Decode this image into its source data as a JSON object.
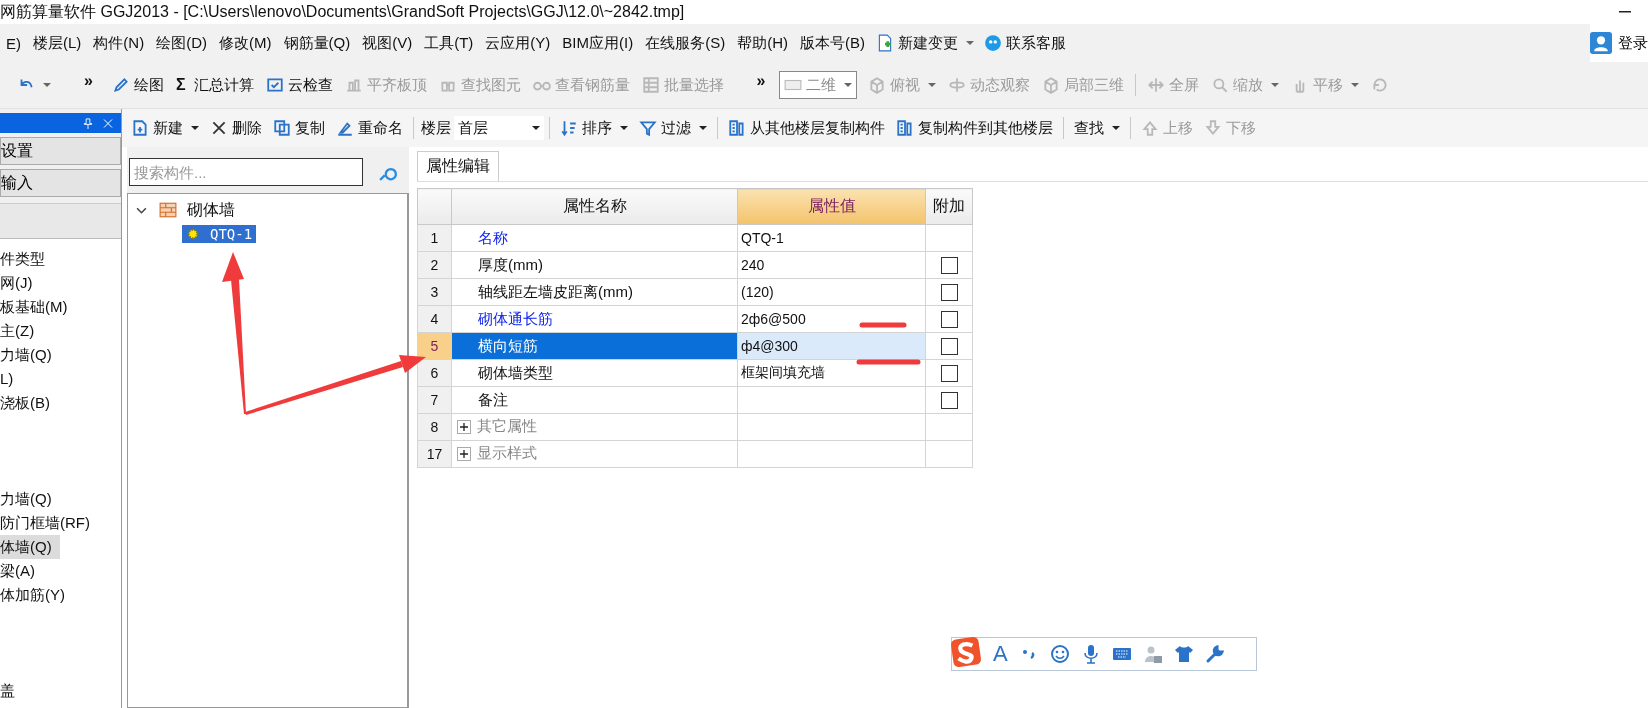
{
  "window": {
    "title": "网筋算量软件 GGJ2013 - [C:\\Users\\lenovo\\Documents\\GrandSoft Projects\\GGJ\\12.0\\~2842.tmp]"
  },
  "menu": {
    "items": [
      "E)",
      "楼层(L)",
      "构件(N)",
      "绘图(D)",
      "修改(M)",
      "钢筋量(Q)",
      "视图(V)",
      "工具(T)",
      "云应用(Y)",
      "BIM应用(I)",
      "在线服务(S)",
      "帮助(H)",
      "版本号(B)"
    ],
    "extras": [
      {
        "label": "新建变更",
        "dropdown": true
      },
      {
        "label": "联系客服",
        "dropdown": false
      }
    ],
    "login": "登录"
  },
  "toolbar": [
    {
      "kind": "icon",
      "disabled": false,
      "dropdown": true
    },
    {
      "kind": "overflow",
      "label": "»"
    },
    {
      "kind": "button",
      "label": "绘图",
      "disabled": false,
      "dropdown": false
    },
    {
      "kind": "button",
      "symbol": "Σ",
      "label": "汇总计算",
      "disabled": false,
      "dropdown": false
    },
    {
      "kind": "button",
      "label": "云检查",
      "disabled": false,
      "dropdown": false
    },
    {
      "kind": "button",
      "label": "平齐板顶",
      "disabled": true,
      "dropdown": false
    },
    {
      "kind": "button",
      "label": "查找图元",
      "disabled": true,
      "dropdown": false
    },
    {
      "kind": "button",
      "label": "查看钢筋量",
      "disabled": true,
      "dropdown": false
    },
    {
      "kind": "button",
      "label": "批量选择",
      "disabled": true,
      "dropdown": false
    },
    {
      "kind": "overflow",
      "label": "»"
    },
    {
      "kind": "select",
      "value": "二维"
    },
    {
      "kind": "button",
      "label": "俯视",
      "disabled": true,
      "dropdown": true
    },
    {
      "kind": "button",
      "label": "动态观察",
      "disabled": true,
      "dropdown": false
    },
    {
      "kind": "button",
      "label": "局部三维",
      "disabled": true,
      "dropdown": false
    },
    {
      "kind": "separator"
    },
    {
      "kind": "button",
      "label": "全屏",
      "disabled": true,
      "dropdown": false
    },
    {
      "kind": "button",
      "label": "缩放",
      "disabled": true,
      "dropdown": true
    },
    {
      "kind": "button",
      "label": "平移",
      "disabled": true,
      "dropdown": true
    },
    {
      "kind": "icon",
      "disabled": true,
      "dropdown": false
    }
  ],
  "left_panel": {
    "buttons": [
      "设置",
      "输入"
    ],
    "groups": [
      [
        {
          "label": "件类型",
          "selected": false
        },
        {
          "label": "网(J)",
          "selected": false
        },
        {
          "label": "板基础(M)",
          "selected": false
        },
        {
          "label": "主(Z)",
          "selected": false
        },
        {
          "label": "力墙(Q)",
          "selected": false
        },
        {
          "label": "L)",
          "selected": false
        },
        {
          "label": "浇板(B)",
          "selected": false
        }
      ],
      [
        {
          "label": "力墙(Q)",
          "selected": false
        },
        {
          "label": "防门框墙(RF)",
          "selected": false
        },
        {
          "label": "体墙(Q)",
          "selected": true
        },
        {
          "label": "梁(A)",
          "selected": false
        },
        {
          "label": "体加筋(Y)",
          "selected": false
        }
      ],
      [
        {
          "label": "盖",
          "selected": false
        }
      ]
    ]
  },
  "component_toolbar": [
    {
      "kind": "button",
      "label": "新建",
      "disabled": false,
      "dropdown": true
    },
    {
      "kind": "button",
      "label": "删除",
      "disabled": false,
      "dropdown": false
    },
    {
      "kind": "button",
      "label": "复制",
      "disabled": false,
      "dropdown": false
    },
    {
      "kind": "button",
      "label": "重命名",
      "disabled": false,
      "dropdown": false
    },
    {
      "kind": "separator"
    },
    {
      "kind": "label",
      "label": "楼层"
    },
    {
      "kind": "select",
      "value": "首层"
    },
    {
      "kind": "separator"
    },
    {
      "kind": "button",
      "label": "排序",
      "disabled": false,
      "dropdown": true
    },
    {
      "kind": "button",
      "label": "过滤",
      "disabled": false,
      "dropdown": true
    },
    {
      "kind": "separator"
    },
    {
      "kind": "button",
      "label": "从其他楼层复制构件",
      "disabled": false,
      "dropdown": false
    },
    {
      "kind": "button",
      "label": "复制构件到其他楼层",
      "disabled": false,
      "dropdown": false
    },
    {
      "kind": "separator"
    },
    {
      "kind": "button",
      "label": "查找",
      "disabled": false,
      "dropdown": true
    },
    {
      "kind": "separator"
    },
    {
      "kind": "button",
      "label": "上移",
      "disabled": true,
      "dropdown": false
    },
    {
      "kind": "button",
      "label": "下移",
      "disabled": true,
      "dropdown": false
    }
  ],
  "tree": {
    "search": {
      "placeholder": "搜索构件..."
    },
    "nodes": [
      {
        "label": "砌体墙",
        "expanded": true,
        "selected": false,
        "children": [
          {
            "label": "QTQ-1",
            "selected": true
          }
        ]
      }
    ]
  },
  "properties": {
    "tab": {
      "label": "属性编辑",
      "selected": true
    },
    "columns": [
      {
        "label": "属性名称",
        "selected": false
      },
      {
        "label": "属性值",
        "selected": true
      },
      {
        "label": "附加",
        "selected": false
      }
    ],
    "rows": [
      {
        "kind": "fixed",
        "number": "1",
        "name": "名称",
        "value": "QTQ-1",
        "public": true,
        "selected": false
      },
      {
        "kind": "property",
        "number": "2",
        "name": "厚度(mm)",
        "value": "240",
        "public": false,
        "selected": false,
        "checked": false
      },
      {
        "kind": "property",
        "number": "3",
        "name": "轴线距左墙皮距离(mm)",
        "value": "(120)",
        "public": false,
        "selected": false,
        "checked": false
      },
      {
        "kind": "property",
        "number": "4",
        "name": "砌体通长筋",
        "value": "2ф6@500",
        "public": true,
        "selected": false,
        "checked": false
      },
      {
        "kind": "property",
        "number": "5",
        "name": "横向短筋",
        "value": "ф4@300",
        "public": false,
        "selected": true,
        "checked": false
      },
      {
        "kind": "property",
        "number": "6",
        "name": "砌体墙类型",
        "value": "框架间填充墙",
        "public": false,
        "selected": false,
        "checked": false
      },
      {
        "kind": "property",
        "number": "7",
        "name": "备注",
        "public": false,
        "selected": false,
        "checked": false
      },
      {
        "kind": "group",
        "number": "8",
        "name": "其它属性",
        "expanded": false
      },
      {
        "kind": "group",
        "number": "17",
        "name": "显示样式",
        "expanded": false
      }
    ]
  },
  "ime_bar": {
    "letter": "A"
  }
}
